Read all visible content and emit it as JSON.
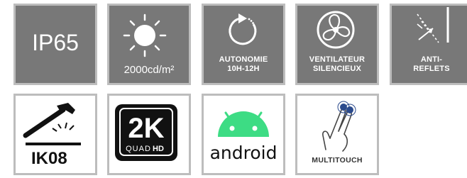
{
  "colors": {
    "tile_dark": "#787878",
    "tile_border": "#bdbdbd",
    "android_green": "#3ddc84"
  },
  "tiles": [
    {
      "text": "IP65"
    },
    {
      "text": "2000cd/m²",
      "icon": "sun-icon"
    },
    {
      "lines": [
        "AUTONOMIE",
        "10H-12H"
      ],
      "icon": "refresh-cycle-icon"
    },
    {
      "lines": [
        "VENTILATEUR",
        "SILENCIEUX"
      ],
      "icon": "fan-icon"
    },
    {
      "lines": [
        "ANTI-",
        "REFLETS"
      ],
      "icon": "anti-glare-icon"
    },
    {
      "text": "IK08",
      "icon": "hammer-impact-icon"
    },
    {
      "badge": "2K",
      "quad": "QUAD",
      "hd": "HD",
      "icon": "quad-hd-badge-icon"
    },
    {
      "text": "android",
      "icon": "android-robot-icon"
    },
    {
      "text": "MULTITOUCH",
      "icon": "two-finger-touch-icon"
    }
  ]
}
